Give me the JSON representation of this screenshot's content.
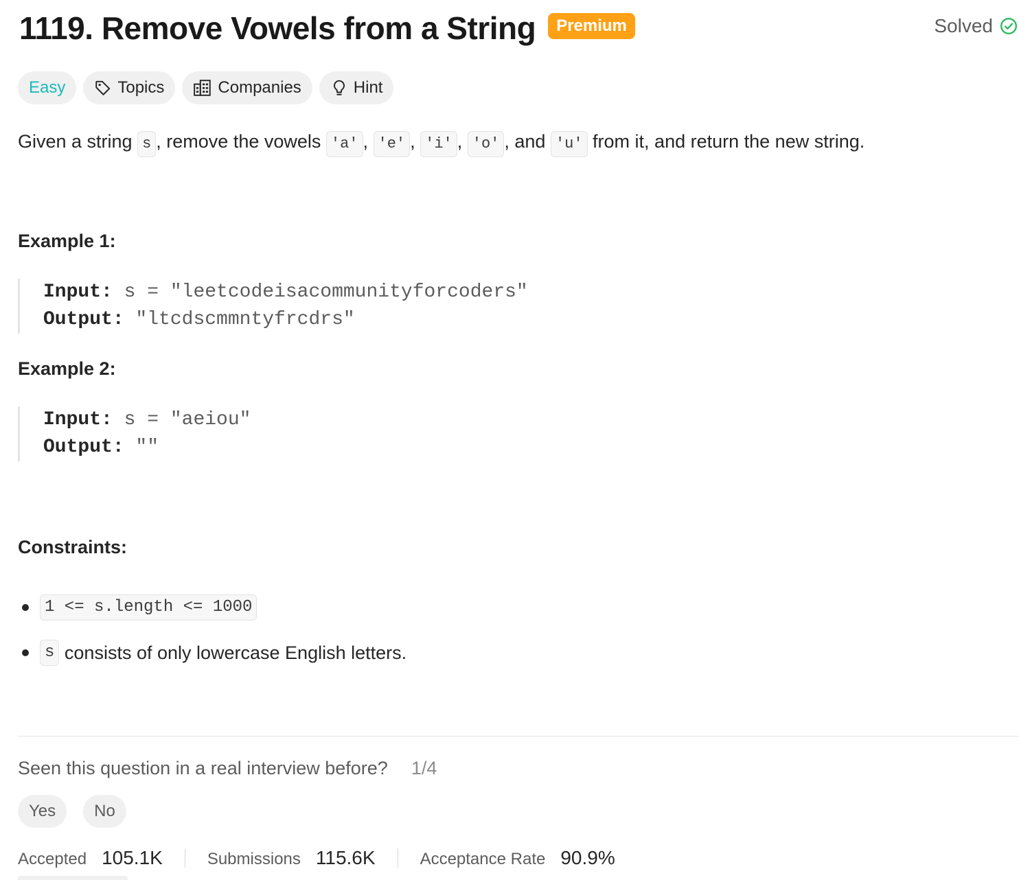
{
  "header": {
    "title": "1119. Remove Vowels from a String",
    "premium_badge": "Premium",
    "status": "Solved"
  },
  "tags": {
    "difficulty": "Easy",
    "topics": "Topics",
    "companies": "Companies",
    "hint": "Hint"
  },
  "description": {
    "p1": "Given a string ",
    "c1": "s",
    "p2": ", remove the vowels ",
    "c2": "'a'",
    "p3": ", ",
    "c3": "'e'",
    "p4": ", ",
    "c4": "'i'",
    "p5": ", ",
    "c5": "'o'",
    "p6": ", and ",
    "c6": "'u'",
    "p7": " from it, and return the new string."
  },
  "examples": [
    {
      "heading": "Example 1:",
      "input_label": "Input:",
      "input_value": " s = \"leetcodeisacommunityforcoders\"",
      "output_label": "Output:",
      "output_value": " \"ltcdscmmntyfrcdrs\""
    },
    {
      "heading": "Example 2:",
      "input_label": "Input:",
      "input_value": " s = \"aeiou\"",
      "output_label": "Output:",
      "output_value": " \"\""
    }
  ],
  "constraints": {
    "heading": "Constraints:",
    "c1_code": "1 <= s.length <= 1000",
    "c2_code": "s",
    "c2_text": " consists of only lowercase English letters."
  },
  "interview": {
    "question": "Seen this question in a real interview before?",
    "count": "1/4",
    "yes": "Yes",
    "no": "No"
  },
  "stats": {
    "accepted_label": "Accepted",
    "accepted_value": "105.1K",
    "submissions_label": "Submissions",
    "submissions_value": "115.6K",
    "rate_label": "Acceptance Rate",
    "rate_value": "90.9%"
  },
  "colors": {
    "premium": "#ffa116",
    "easy": "#1cbaba",
    "solved_check": "#2cbb5d"
  },
  "icons": [
    "tag-icon",
    "building-icon",
    "lightbulb-icon",
    "check-circle-icon"
  ]
}
